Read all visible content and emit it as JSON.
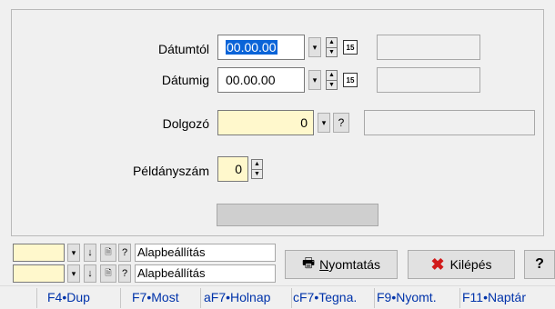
{
  "form": {
    "datumtol_label": "Dátumtól",
    "datumtol_value": "00.00.00",
    "datumig_label": "Dátumig",
    "datumig_value": "00.00.00",
    "dolgozo_label": "Dolgozó",
    "dolgozo_value": "0",
    "peldanyszam_label": "Példányszám",
    "peldanyszam_value": "0",
    "calendar_glyph": "15",
    "help_glyph": "?",
    "dropdown_glyph": "▾"
  },
  "presets": [
    {
      "label": "Alapbeállítás"
    },
    {
      "label": "Alapbeállítás"
    }
  ],
  "buttons": {
    "print_prefix": "N",
    "print_rest": "yomtatás",
    "exit_label": "Kilépés",
    "help_label": "?"
  },
  "fkeys": [
    {
      "label": "F4•Dup"
    },
    {
      "label": "F7•Most"
    },
    {
      "label": "aF7•Holnap"
    },
    {
      "label": "cF7•Tegna."
    },
    {
      "label": "F9•Nyomt."
    },
    {
      "label": "F11•Naptár"
    }
  ],
  "colors": {
    "accent": "#0a64d8",
    "exit_icon": "#d11a1a",
    "fkey_text": "#0033aa",
    "field_yellow": "#fff8cc"
  }
}
